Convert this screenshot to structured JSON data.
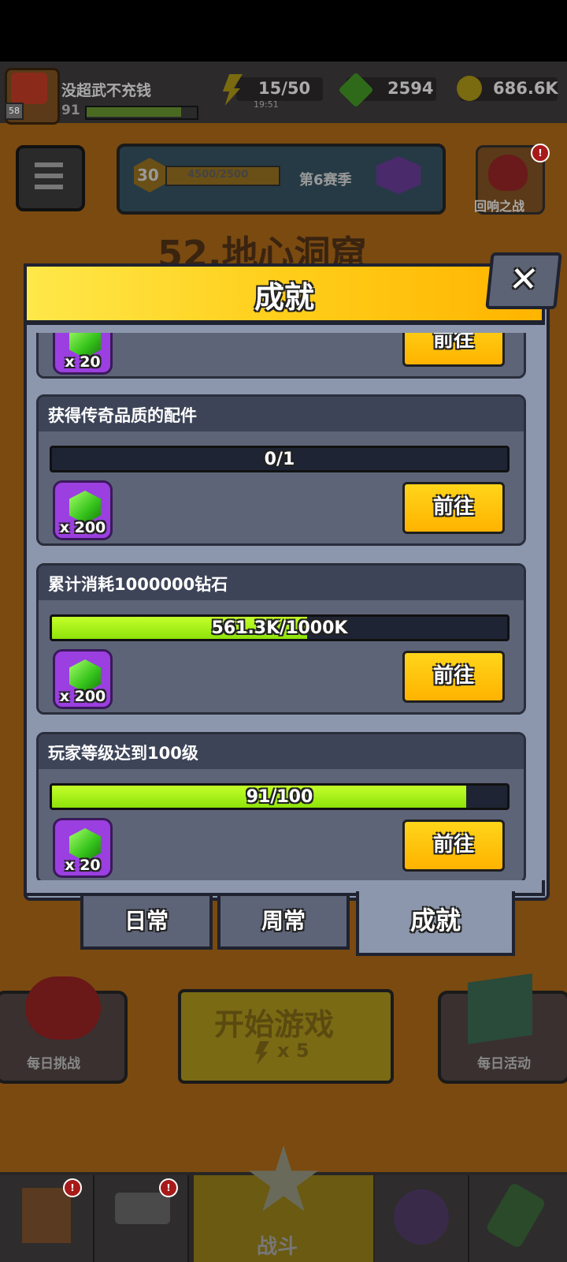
{
  "player": {
    "name": "没超武不充钱",
    "level": "91",
    "badge": "58"
  },
  "resources": {
    "energy": "15/50",
    "energy_timer": "19:51",
    "gems": "2594",
    "coins": "686.6K"
  },
  "season": {
    "rank": "30",
    "progress": "4500/2500",
    "label": "第6赛季"
  },
  "echo_battle": {
    "label": "回响之战",
    "badge": "!"
  },
  "stage_title": "52.地心洞窟",
  "modal": {
    "title": "成就",
    "close_glyph": "✕",
    "achievements": [
      {
        "title": "",
        "progress_text": "",
        "fraction": 0,
        "reward_qty": "x 20",
        "button": "前往"
      },
      {
        "title": "获得传奇品质的配件",
        "progress_text": "0/1",
        "fraction": 0,
        "reward_qty": "x 200",
        "button": "前往"
      },
      {
        "title": "累计消耗1000000钻石",
        "progress_text": "561.3K/1000K",
        "fraction": 0.5613,
        "reward_qty": "x 200",
        "button": "前往"
      },
      {
        "title": "玩家等级达到100级",
        "progress_text": "91/100",
        "fraction": 0.91,
        "reward_qty": "x 20",
        "button": "前往"
      }
    ],
    "tabs": [
      {
        "label": "日常",
        "active": false
      },
      {
        "label": "周常",
        "active": false
      },
      {
        "label": "成就",
        "active": true
      }
    ]
  },
  "bottom": {
    "daily_challenge": "每日挑战",
    "start_game": "开始游戏",
    "start_cost": "x 5",
    "daily_event": "每日活动"
  },
  "nav": {
    "battle_label": "战斗",
    "shop_badge": "!",
    "weapon_badge": "!"
  },
  "icons": {
    "energy": "lightning-icon",
    "gem": "green-gem-icon",
    "coin": "gold-coin-icon",
    "menu": "hamburger-menu-icon",
    "close": "close-icon"
  }
}
